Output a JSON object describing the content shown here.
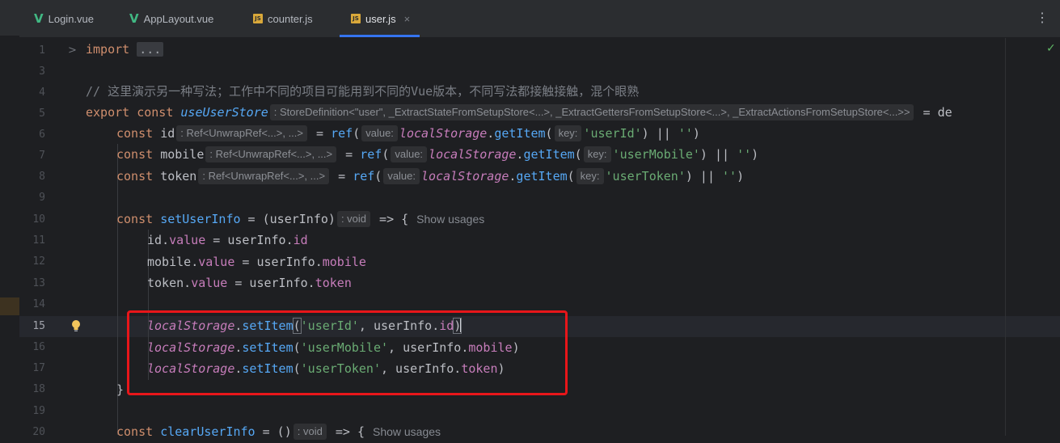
{
  "tabs": [
    {
      "label": "Login.vue",
      "icon": "vue-icon",
      "active": false
    },
    {
      "label": "AppLayout.vue",
      "icon": "vue-icon",
      "active": false
    },
    {
      "label": "counter.js",
      "icon": "js-icon",
      "active": false
    },
    {
      "label": "user.js",
      "icon": "js-icon",
      "active": true
    }
  ],
  "icons": {
    "vue_glyph": "V",
    "js_glyph": "JS",
    "close_glyph": "×",
    "more_glyph": "⋮",
    "fold_glyph": ">",
    "check_glyph": "✓"
  },
  "line_numbers": [
    "1",
    "3",
    "4",
    "5",
    "6",
    "7",
    "8",
    "9",
    "10",
    "11",
    "12",
    "13",
    "14",
    "15",
    "16",
    "17",
    "18",
    "19",
    "20"
  ],
  "code": {
    "l1": {
      "kw": "import",
      "collapsed": "..."
    },
    "l4": {
      "comment": "// 这里演示另一种写法；工作中不同的项目可能用到不同的Vue版本，不同写法都接触接触，混个眼熟"
    },
    "l5": {
      "kw1": "export",
      "kw2": "const",
      "name": "useUserStore",
      "hint": ": StoreDefinition<\"user\", _ExtractStateFromSetupStore<...>, _ExtractGettersFromSetupStore<...>, _ExtractActionsFromSetupStore<...>>",
      "rest": " = de"
    },
    "l6": {
      "kw": "const",
      "var": "id",
      "hint": ": Ref<UnwrapRef<...>, ...>",
      "eq": " = ",
      "ref": "ref",
      "p1": "(",
      "hint_value": "value:",
      "ls": "localStorage",
      "dot": ".",
      "getItem": "getItem",
      "p2": "(",
      "hint_key": "key:",
      "str": "'userId'",
      "rest1": ") || ",
      "str2": "''",
      "rest2": ")"
    },
    "l7": {
      "kw": "const",
      "var": "mobile",
      "hint": ": Ref<UnwrapRef<...>, ...>",
      "eq": " = ",
      "ref": "ref",
      "p1": "(",
      "hint_value": "value:",
      "ls": "localStorage",
      "dot": ".",
      "getItem": "getItem",
      "p2": "(",
      "hint_key": "key:",
      "str": "'userMobile'",
      "rest1": ") || ",
      "str2": "''",
      "rest2": ")"
    },
    "l8": {
      "kw": "const",
      "var": "token",
      "hint": ": Ref<UnwrapRef<...>, ...>",
      "eq": " = ",
      "ref": "ref",
      "p1": "(",
      "hint_value": "value:",
      "ls": "localStorage",
      "dot": ".",
      "getItem": "getItem",
      "p2": "(",
      "hint_key": "key:",
      "str": "'userToken'",
      "rest1": ") || ",
      "str2": "''",
      "rest2": ")"
    },
    "l10": {
      "kw": "const",
      "fn": "setUserInfo",
      "rest": " = (userInfo)",
      "hint": ": void",
      "arrow": " => {",
      "usages": "Show usages"
    },
    "l11": {
      "var": "id",
      "dot": ".",
      "prop": "value",
      "mid": " = userInfo.",
      "prop2": "id"
    },
    "l12": {
      "var": "mobile",
      "dot": ".",
      "prop": "value",
      "mid": " = userInfo.",
      "prop2": "mobile"
    },
    "l13": {
      "var": "token",
      "dot": ".",
      "prop": "value",
      "mid": " = userInfo.",
      "prop2": "token"
    },
    "l15": {
      "ls": "localStorage",
      "dot": ".",
      "fn": "setItem",
      "open": "(",
      "str": "'userId'",
      "mid": ", userInfo.",
      "prop": "id",
      "close": ")"
    },
    "l16": {
      "ls": "localStorage",
      "dot": ".",
      "fn": "setItem",
      "open": "(",
      "str": "'userMobile'",
      "mid": ", userInfo.",
      "prop": "mobile",
      "close": ")"
    },
    "l17": {
      "ls": "localStorage",
      "dot": ".",
      "fn": "setItem",
      "open": "(",
      "str": "'userToken'",
      "mid": ", userInfo.",
      "prop": "token",
      "close": ")"
    },
    "l18": {
      "brace": "}"
    },
    "l20": {
      "kw": "const",
      "fn": "clearUserInfo",
      "rest": " = ()",
      "hint": ": void",
      "arrow": " => {",
      "usages": "Show usages"
    }
  },
  "colors": {
    "editor_bg": "#1e1f22",
    "keyword": "#cf8e6d",
    "function": "#56a8f5",
    "string": "#6aab73",
    "property": "#c77dbb",
    "highlight_box": "#e8161a",
    "tab_underline": "#3574f0"
  }
}
